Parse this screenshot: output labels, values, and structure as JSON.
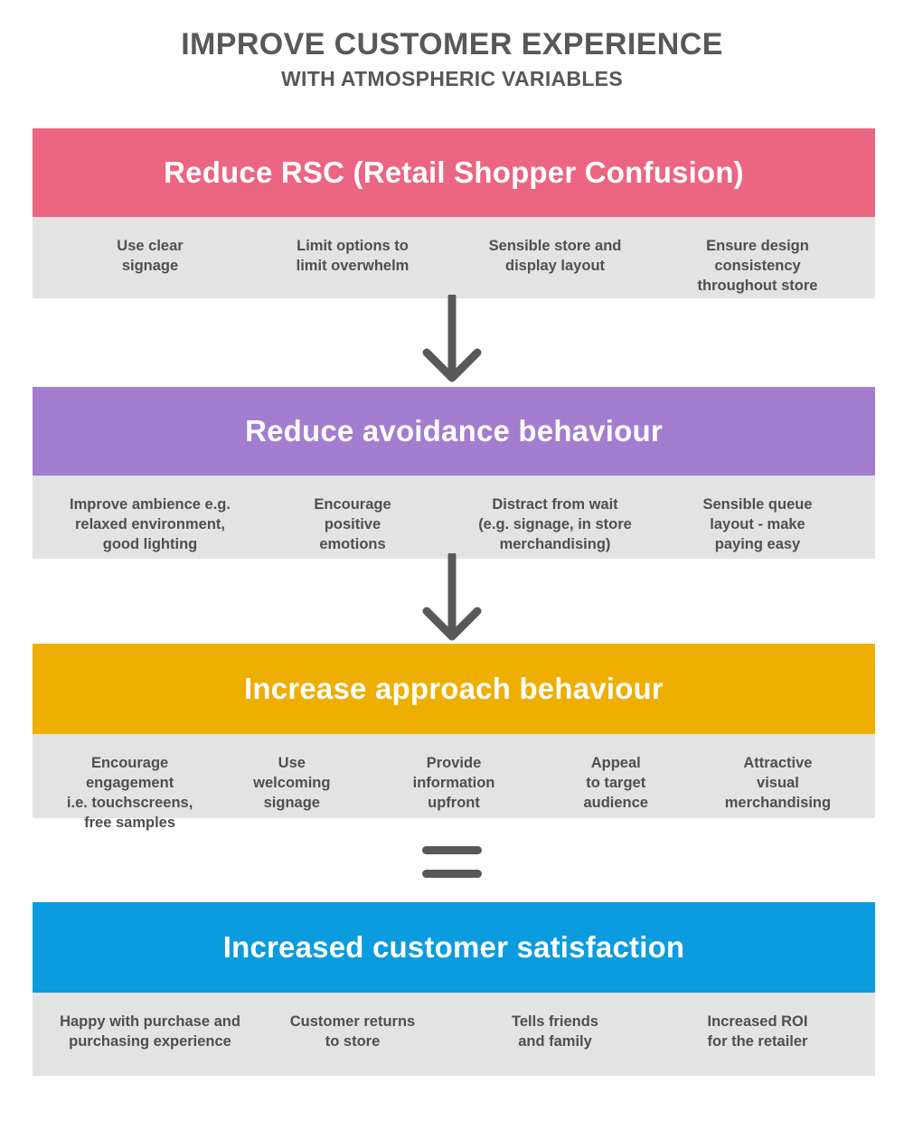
{
  "title": {
    "main": "Improve Customer Experience",
    "sub": "With Atmospheric Variables"
  },
  "colors": {
    "pink": "#ec6582",
    "purple": "#a47cd0",
    "orange": "#efae02",
    "blue": "#0a9cde",
    "grey_block": "#e3e3e3",
    "text_dark": "#58585a",
    "item_text": "#4f4f51",
    "connector": "#58585a"
  },
  "sections": [
    {
      "id": "reduce-rsc",
      "heading": "Reduce RSC (Retail Shopper Confusion)",
      "color": "#ec6582",
      "items": [
        "Use clear\nsignage",
        "Limit options to\nlimit overwhelm",
        "Sensible store and\ndisplay layout",
        "Ensure design consistency\nthroughout store"
      ]
    },
    {
      "id": "reduce-avoidance-behaviour",
      "heading": "Reduce avoidance behaviour",
      "color": "#a47cd0",
      "items": [
        "Improve ambience e.g.\nrelaxed environment,\ngood lighting",
        "Encourage\npositive\nemotions",
        "Distract from wait\n(e.g. signage, in store\nmerchandising)",
        "Sensible queue\nlayout - make\npaying easy"
      ]
    },
    {
      "id": "increase-approach-behaviour",
      "heading": "Increase approach behaviour",
      "color": "#efae02",
      "items": [
        "Encourage engagement\ni.e. touchscreens,\nfree samples",
        "Use\nwelcoming\nsignage",
        "Provide\ninformation\nupfront",
        "Appeal\nto target\naudience",
        "Attractive\nvisual\nmerchandising"
      ]
    },
    {
      "id": "increased-customer-satisfaction",
      "heading": "Increased customer satisfaction",
      "color": "#0a9cde",
      "items": [
        "Happy with purchase and\npurchasing experience",
        "Customer returns\nto store",
        "Tells friends\nand family",
        "Increased ROI\nfor the retailer"
      ]
    }
  ],
  "connectors": [
    {
      "id": "arrow-rsc-to-avoidance",
      "type": "down-arrow"
    },
    {
      "id": "arrow-avoidance-to-approach",
      "type": "down-arrow"
    },
    {
      "id": "equals-approach-to-satisfaction",
      "type": "equals"
    }
  ]
}
